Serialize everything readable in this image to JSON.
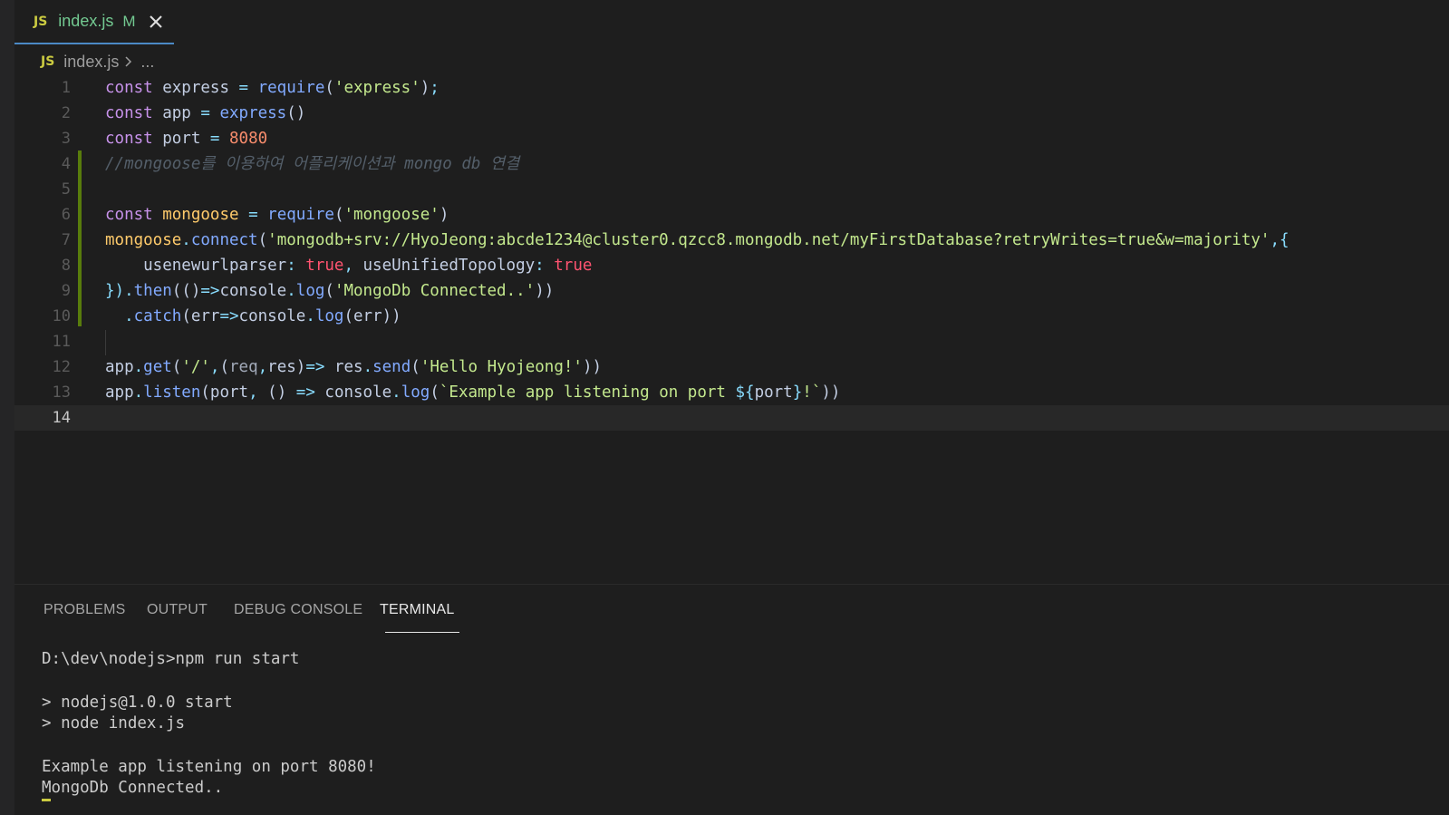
{
  "editor": {
    "tab": {
      "icon_label": "JS",
      "filename": "index.js",
      "modified_badge": "M"
    },
    "breadcrumb": {
      "icon_label": "JS",
      "file": "index.js",
      "more": "..."
    },
    "lines": [
      {
        "n": "1",
        "tokens": [
          [
            "t-const",
            "const"
          ],
          [
            "t-var",
            " express "
          ],
          [
            "t-op",
            "="
          ],
          [
            "t-var",
            " "
          ],
          [
            "t-fn",
            "require"
          ],
          [
            "t-paren",
            "("
          ],
          [
            "t-str",
            "'express'"
          ],
          [
            "t-paren",
            ")"
          ],
          [
            "t-op",
            ";"
          ]
        ]
      },
      {
        "n": "2",
        "tokens": [
          [
            "t-const",
            "const"
          ],
          [
            "t-var",
            " app "
          ],
          [
            "t-op",
            "="
          ],
          [
            "t-var",
            " "
          ],
          [
            "t-fn",
            "express"
          ],
          [
            "t-paren",
            "()"
          ]
        ]
      },
      {
        "n": "3",
        "tokens": [
          [
            "t-const",
            "const"
          ],
          [
            "t-var",
            " port "
          ],
          [
            "t-op",
            "="
          ],
          [
            "t-var",
            " "
          ],
          [
            "t-num",
            "8080"
          ]
        ]
      },
      {
        "n": "4",
        "tokens": [
          [
            "t-cm",
            "//mongoose를 이용하여 어플리케이션과 mongo db 연결"
          ]
        ]
      },
      {
        "n": "5",
        "tokens": []
      },
      {
        "n": "6",
        "tokens": [
          [
            "t-const",
            "const"
          ],
          [
            "t-var",
            " "
          ],
          [
            "t-obj",
            "mongoose"
          ],
          [
            "t-var",
            " "
          ],
          [
            "t-op",
            "="
          ],
          [
            "t-var",
            " "
          ],
          [
            "t-fn",
            "require"
          ],
          [
            "t-paren",
            "("
          ],
          [
            "t-str",
            "'mongoose'"
          ],
          [
            "t-paren",
            ")"
          ]
        ]
      },
      {
        "n": "7",
        "tokens": [
          [
            "t-obj",
            "mongoose"
          ],
          [
            "t-op",
            "."
          ],
          [
            "t-fn",
            "connect"
          ],
          [
            "t-paren",
            "("
          ],
          [
            "t-str",
            "'mongodb+srv://HyoJeong:abcde1234@cluster0.qzcc8.mongodb.net/myFirstDatabase?retryWrites=true&w=majority'"
          ],
          [
            "t-op",
            ",{"
          ]
        ]
      },
      {
        "n": "8",
        "tokens": [
          [
            "t-prop",
            "    usenewurlparser"
          ],
          [
            "t-op",
            ":"
          ],
          [
            "t-var",
            " "
          ],
          [
            "t-bool",
            "true"
          ],
          [
            "t-op",
            ","
          ],
          [
            "t-prop",
            " useUnifiedTopology"
          ],
          [
            "t-op",
            ":"
          ],
          [
            "t-var",
            " "
          ],
          [
            "t-bool",
            "true"
          ]
        ]
      },
      {
        "n": "9",
        "tokens": [
          [
            "t-op",
            "})"
          ],
          [
            "t-op",
            "."
          ],
          [
            "t-fn",
            "then"
          ],
          [
            "t-paren",
            "(()"
          ],
          [
            "t-op",
            "=>"
          ],
          [
            "t-var",
            "console"
          ],
          [
            "t-op",
            "."
          ],
          [
            "t-fn",
            "log"
          ],
          [
            "t-paren",
            "("
          ],
          [
            "t-str",
            "'MongoDb Connected..'"
          ],
          [
            "t-paren",
            "))"
          ]
        ]
      },
      {
        "n": "10",
        "tokens": [
          [
            "t-var",
            "  "
          ],
          [
            "t-op",
            "."
          ],
          [
            "t-fn",
            "catch"
          ],
          [
            "t-paren",
            "("
          ],
          [
            "t-var",
            "err"
          ],
          [
            "t-op",
            "=>"
          ],
          [
            "t-var",
            "console"
          ],
          [
            "t-op",
            "."
          ],
          [
            "t-fn",
            "log"
          ],
          [
            "t-paren",
            "("
          ],
          [
            "t-var",
            "err"
          ],
          [
            "t-paren",
            "))"
          ]
        ]
      },
      {
        "n": "11",
        "tokens": []
      },
      {
        "n": "12",
        "tokens": [
          [
            "t-var",
            "app"
          ],
          [
            "t-op",
            "."
          ],
          [
            "t-fn",
            "get"
          ],
          [
            "t-paren",
            "("
          ],
          [
            "t-str",
            "'/'"
          ],
          [
            "t-op",
            ","
          ],
          [
            "t-paren",
            "("
          ],
          [
            "t-param",
            "req"
          ],
          [
            "t-op",
            ","
          ],
          [
            "t-var",
            "res"
          ],
          [
            "t-paren",
            ")"
          ],
          [
            "t-op",
            "=>"
          ],
          [
            "t-var",
            " res"
          ],
          [
            "t-op",
            "."
          ],
          [
            "t-fn",
            "send"
          ],
          [
            "t-paren",
            "("
          ],
          [
            "t-str",
            "'Hello Hyojeong!'"
          ],
          [
            "t-paren",
            "))"
          ]
        ]
      },
      {
        "n": "13",
        "tokens": [
          [
            "t-var",
            "app"
          ],
          [
            "t-op",
            "."
          ],
          [
            "t-fn",
            "listen"
          ],
          [
            "t-paren",
            "("
          ],
          [
            "t-var",
            "port"
          ],
          [
            "t-op",
            ","
          ],
          [
            "t-var",
            " "
          ],
          [
            "t-paren",
            "()"
          ],
          [
            "t-var",
            " "
          ],
          [
            "t-op",
            "=>"
          ],
          [
            "t-var",
            " console"
          ],
          [
            "t-op",
            "."
          ],
          [
            "t-fn",
            "log"
          ],
          [
            "t-paren",
            "("
          ],
          [
            "t-str",
            "`Example app listening on port "
          ],
          [
            "t-tmpl",
            "${"
          ],
          [
            "t-var",
            "port"
          ],
          [
            "t-tmpl",
            "}"
          ],
          [
            "t-str",
            "!`"
          ],
          [
            "t-paren",
            "))"
          ]
        ]
      },
      {
        "n": "14",
        "tokens": []
      }
    ]
  },
  "panel": {
    "tabs": [
      "PROBLEMS",
      "OUTPUT",
      "DEBUG CONSOLE",
      "TERMINAL"
    ],
    "active_tab": "TERMINAL",
    "terminal_lines": [
      "D:\\dev\\nodejs>npm run start",
      "",
      "> nodejs@1.0.0 start",
      "> node index.js",
      "",
      "Example app listening on port 8080!",
      "MongoDb Connected.."
    ]
  }
}
